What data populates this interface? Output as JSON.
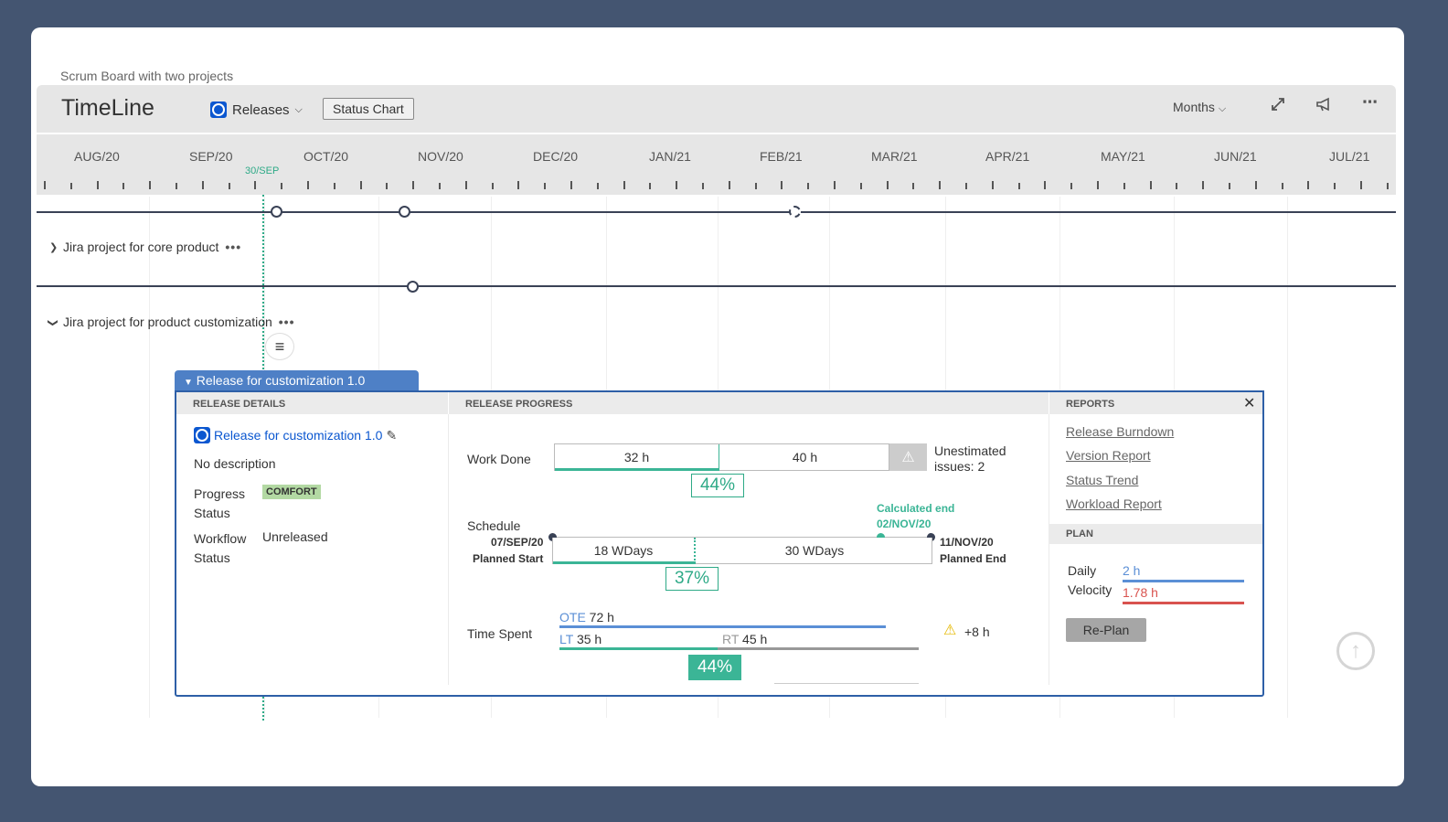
{
  "board": {
    "name": "Scrum Board with two projects"
  },
  "header": {
    "title": "TimeLine",
    "releases_label": "Releases",
    "status_chart_label": "Status Chart",
    "scale_label": "Months"
  },
  "timeline": {
    "months": [
      "AUG/20",
      "SEP/20",
      "OCT/20",
      "NOV/20",
      "DEC/20",
      "JAN/21",
      "FEB/21",
      "MAR/21",
      "APR/21",
      "MAY/21",
      "JUN/21",
      "JUL/21"
    ],
    "today_label": "30/SEP"
  },
  "projects": [
    {
      "name": "Jira project for core product",
      "expanded": false
    },
    {
      "name": "Jira project for product customization",
      "expanded": true
    }
  ],
  "release": {
    "tab_label": "Release for customization 1.0",
    "details": {
      "heading": "RELEASE DETAILS",
      "name": "Release for customization 1.0",
      "description": "No description",
      "progress_status_label": "Progress Status",
      "progress_status_value": "COMFORT",
      "workflow_status_label": "Workflow Status",
      "workflow_status_value": "Unreleased"
    },
    "progress": {
      "heading": "RELEASE PROGRESS",
      "work_done": {
        "label": "Work Done",
        "done": "32 h",
        "remaining": "40 h",
        "percent": "44%",
        "unestimated": "Unestimated issues: 2"
      },
      "schedule": {
        "label": "Schedule",
        "calculated_end_label": "Calculated end",
        "calculated_end_date": "02/NOV/20",
        "planned_start_date": "07/SEP/20",
        "planned_start_label": "Planned Start",
        "planned_end_date": "11/NOV/20",
        "planned_end_label": "Planned End",
        "elapsed": "18 WDays",
        "remaining": "30 WDays",
        "percent": "37%"
      },
      "time_spent": {
        "label": "Time Spent",
        "ote_label": "OTE",
        "ote_value": "72 h",
        "lt_label": "LT",
        "lt_value": "35 h",
        "rt_label": "RT",
        "rt_value": "45 h",
        "percent": "44%",
        "overrun": "+8 h"
      }
    },
    "reports": {
      "heading": "REPORTS",
      "links": [
        "Release Burndown",
        "Version Report",
        "Status Trend",
        "Workload Report"
      ]
    },
    "plan": {
      "heading": "PLAN",
      "velocity_label": "Daily Velocity",
      "planned_velocity": "2 h",
      "actual_velocity": "1.78 h",
      "replan_label": "Re-Plan"
    }
  },
  "colors": {
    "frame": "#445571",
    "accent_blue": "#0b57d0",
    "progress_green": "#3bb596",
    "velocity_blue": "#5b8fd6",
    "velocity_red": "#d9534f"
  }
}
